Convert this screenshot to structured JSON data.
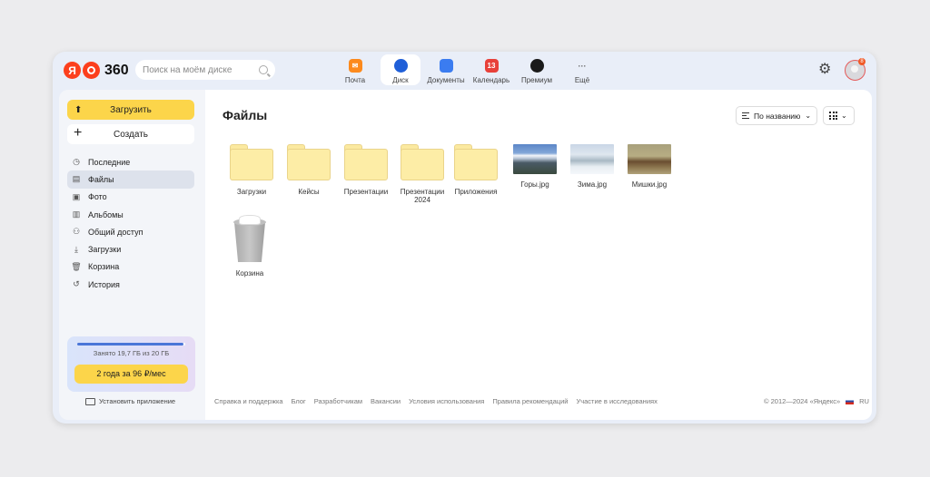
{
  "header": {
    "logo_text": "360",
    "logo_letter": "Я",
    "search_placeholder": "Поиск на моём диске",
    "apps": [
      {
        "label": "Почта",
        "icon": "mail-icon",
        "color": "#fc8a1d"
      },
      {
        "label": "Диск",
        "icon": "disk-icon",
        "color": "#1f5fd8",
        "active": true
      },
      {
        "label": "Документы",
        "icon": "documents-icon",
        "color": "#3b7cf0"
      },
      {
        "label": "Календарь",
        "icon": "calendar-icon",
        "color": "#e8413a",
        "text": "13"
      },
      {
        "label": "Премиум",
        "icon": "premium-icon",
        "color": "#1a1a1a"
      },
      {
        "label": "Ещё",
        "icon": "more-icon",
        "text": "···"
      }
    ],
    "notifications": "8"
  },
  "sidebar": {
    "upload_label": "Загрузить",
    "create_label": "Создать",
    "items": [
      {
        "label": "Последние",
        "icon": "clock-icon"
      },
      {
        "label": "Файлы",
        "icon": "file-icon",
        "active": true
      },
      {
        "label": "Фото",
        "icon": "photo-icon"
      },
      {
        "label": "Альбомы",
        "icon": "albums-icon"
      },
      {
        "label": "Общий доступ",
        "icon": "shared-icon"
      },
      {
        "label": "Загрузки",
        "icon": "download-icon"
      },
      {
        "label": "Корзина",
        "icon": "trash-icon"
      },
      {
        "label": "История",
        "icon": "history-icon"
      }
    ],
    "storage_used_text": "Занято 19,7 ГБ из 20 ГБ",
    "storage_fraction": 0.985,
    "promo_label": "2 года за 96 ₽/мес",
    "install_label": "Установить приложение"
  },
  "main": {
    "title": "Файлы",
    "sort_label": "По названию",
    "files": [
      {
        "name": "Загрузки",
        "kind": "folder"
      },
      {
        "name": "Кейсы",
        "kind": "folder"
      },
      {
        "name": "Презентации",
        "kind": "folder"
      },
      {
        "name": "Презентации 2024",
        "kind": "folder"
      },
      {
        "name": "Приложения",
        "kind": "folder"
      },
      {
        "name": "Горы.jpg",
        "kind": "image"
      },
      {
        "name": "Зима.jpg",
        "kind": "image"
      },
      {
        "name": "Мишки.jpg",
        "kind": "image"
      },
      {
        "name": "Корзина",
        "kind": "trash"
      }
    ]
  },
  "footer": {
    "links": [
      "Справка и поддержка",
      "Блог",
      "Разработчикам",
      "Вакансии",
      "Условия использования",
      "Правила рекомендаций",
      "Участие в исследованиях"
    ],
    "copyright": "© 2012—2024 «Яндекс»",
    "lang": "RU"
  }
}
